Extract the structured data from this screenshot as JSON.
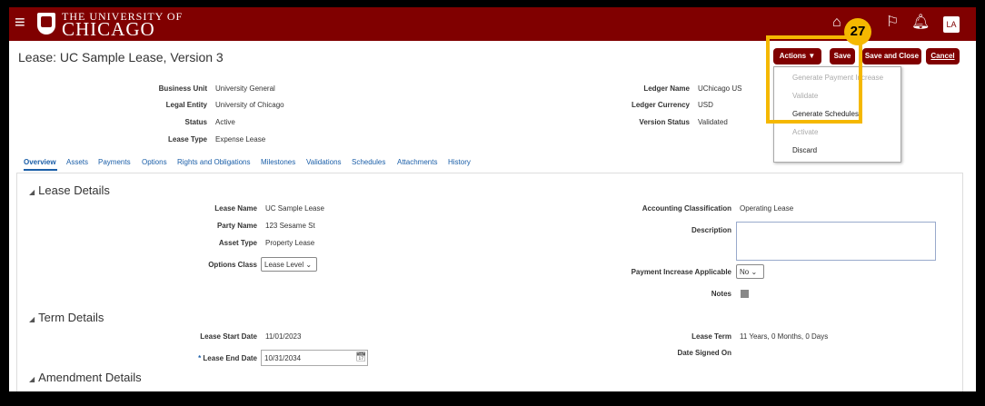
{
  "header": {
    "logo_small": "THE UNIVERSITY OF",
    "logo_big": "CHICAGO",
    "avatar_initials": "LA",
    "icons": [
      "menu-icon",
      "home-icon",
      "flag-icon",
      "bell-icon"
    ]
  },
  "page": {
    "title": "Lease: UC Sample Lease, Version 3"
  },
  "toolbar": {
    "actions": "Actions",
    "actions_arrow": "▼",
    "save": "Save",
    "save_close": "Save and Close",
    "cancel": "Cancel"
  },
  "actions_menu": {
    "items": [
      {
        "label": "Generate Payment Increase",
        "enabled": false
      },
      {
        "label": "Validate",
        "enabled": false
      },
      {
        "label": "Generate Schedules",
        "enabled": true
      },
      {
        "label": "Activate",
        "enabled": false
      },
      {
        "label": "Discard",
        "enabled": true
      }
    ]
  },
  "callout": {
    "step": "27",
    "color": "#f5b800"
  },
  "summary": {
    "left": [
      {
        "label": "Business Unit",
        "value": "University General"
      },
      {
        "label": "Legal Entity",
        "value": "University of Chicago"
      },
      {
        "label": "Status",
        "value": "Active"
      },
      {
        "label": "Lease Type",
        "value": "Expense Lease"
      }
    ],
    "right": [
      {
        "label": "Ledger Name",
        "value": "UChicago US"
      },
      {
        "label": "Ledger Currency",
        "value": "USD"
      },
      {
        "label": "Version Status",
        "value": "Validated"
      }
    ]
  },
  "tabs": [
    "Overview",
    "Assets",
    "Payments",
    "Options",
    "Rights and Obligations",
    "Milestones",
    "Validations",
    "Schedules",
    "Attachments",
    "History"
  ],
  "lease_details": {
    "title": "Lease Details",
    "lease_name_label": "Lease Name",
    "lease_name": "UC Sample Lease",
    "party_name_label": "Party Name",
    "party_name": "123 Sesame St",
    "asset_type_label": "Asset Type",
    "asset_type": "Property Lease",
    "options_class_label": "Options Class",
    "options_class": "Lease Level",
    "accounting_class_label": "Accounting Classification",
    "accounting_class": "Operating Lease",
    "description_label": "Description",
    "payment_increase_label": "Payment Increase Applicable",
    "payment_increase": "No",
    "notes_label": "Notes"
  },
  "term_details": {
    "title": "Term Details",
    "start_label": "Lease Start Date",
    "start": "11/01/2023",
    "end_label": "Lease End Date",
    "end": "10/31/2034",
    "term_label": "Lease Term",
    "term": "11 Years, 0 Months, 0 Days",
    "signed_label": "Date Signed On"
  },
  "amendment": {
    "title": "Amendment Details"
  },
  "colors": {
    "brand": "#800000",
    "link": "#1a5ea8",
    "highlight": "#f5b800"
  }
}
